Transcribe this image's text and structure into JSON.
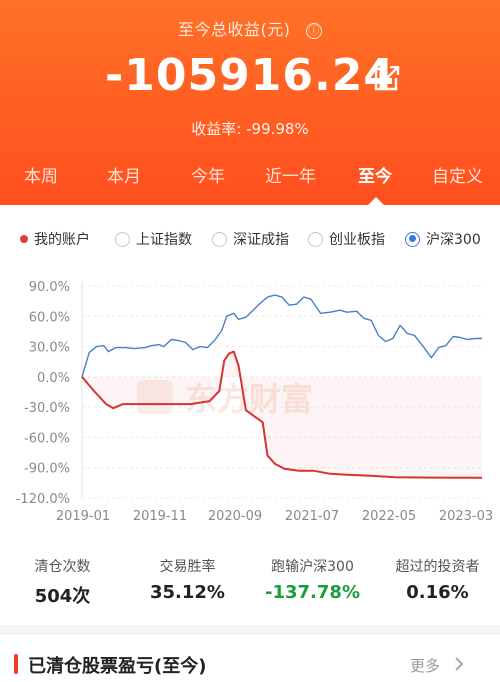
{
  "header": {
    "title": "至今总收益(元)",
    "info_icon": "ⓘ",
    "amount": "-105916.24",
    "rate_label": "收益率:",
    "rate_value": "-99.98%"
  },
  "tabs": [
    {
      "label": "本周"
    },
    {
      "label": "本月"
    },
    {
      "label": "今年"
    },
    {
      "label": "近一年"
    },
    {
      "label": "至今",
      "active": true
    },
    {
      "label": "自定义"
    }
  ],
  "legend": [
    {
      "label": "我的账户",
      "type": "dot"
    },
    {
      "label": "上证指数",
      "type": "radio",
      "selected": false
    },
    {
      "label": "深证成指",
      "type": "radio",
      "selected": false
    },
    {
      "label": "创业板指",
      "type": "radio",
      "selected": false
    },
    {
      "label": "沪深300",
      "type": "radio",
      "selected": true
    }
  ],
  "chart_data": {
    "type": "line",
    "watermark": "东方财富",
    "y_ticks": [
      "90.0%",
      "60.0%",
      "30.0%",
      "0.0%",
      "-30.0%",
      "-60.0%",
      "-90.0%",
      "-120.0%"
    ],
    "x_ticks": [
      "2019-01",
      "2019-11",
      "2020-09",
      "2021-07",
      "2022-05",
      "2023-03"
    ],
    "ylim": [
      -120,
      90
    ],
    "grid": true,
    "series": [
      {
        "name": "沪深300",
        "color": "#4a7fc9",
        "points": [
          [
            0,
            0
          ],
          [
            0.3,
            24
          ],
          [
            0.6,
            30
          ],
          [
            0.9,
            31
          ],
          [
            1.1,
            25
          ],
          [
            1.4,
            29
          ],
          [
            1.8,
            29
          ],
          [
            2.2,
            28
          ],
          [
            2.6,
            29
          ],
          [
            2.9,
            31
          ],
          [
            3.2,
            32
          ],
          [
            3.4,
            30
          ],
          [
            3.7,
            37
          ],
          [
            4.0,
            36
          ],
          [
            4.3,
            34
          ],
          [
            4.6,
            27
          ],
          [
            4.9,
            30
          ],
          [
            5.2,
            29
          ],
          [
            5.5,
            36
          ],
          [
            5.8,
            46
          ],
          [
            6.0,
            60
          ],
          [
            6.3,
            63
          ],
          [
            6.5,
            57
          ],
          [
            6.8,
            59
          ],
          [
            7.1,
            66
          ],
          [
            7.4,
            73
          ],
          [
            7.7,
            79
          ],
          [
            8.0,
            81
          ],
          [
            8.3,
            79
          ],
          [
            8.6,
            71
          ],
          [
            8.9,
            72
          ],
          [
            9.2,
            79
          ],
          [
            9.5,
            77
          ],
          [
            9.9,
            63
          ],
          [
            10.3,
            64
          ],
          [
            10.7,
            66
          ],
          [
            11.0,
            64
          ],
          [
            11.4,
            65
          ],
          [
            11.7,
            58
          ],
          [
            12.0,
            56
          ],
          [
            12.3,
            41
          ],
          [
            12.6,
            35
          ],
          [
            12.9,
            38
          ],
          [
            13.2,
            51
          ],
          [
            13.5,
            43
          ],
          [
            13.8,
            41
          ],
          [
            14.1,
            32
          ],
          [
            14.5,
            19
          ],
          [
            14.8,
            29
          ],
          [
            15.1,
            31
          ],
          [
            15.4,
            40
          ],
          [
            15.7,
            39
          ],
          [
            16.0,
            37
          ],
          [
            16.3,
            38
          ],
          [
            16.6,
            38
          ]
        ]
      },
      {
        "name": "我的账户",
        "color": "#d83232",
        "points": [
          [
            0,
            0
          ],
          [
            0.5,
            -14
          ],
          [
            1.0,
            -27
          ],
          [
            1.3,
            -31
          ],
          [
            1.7,
            -27
          ],
          [
            2.5,
            -27
          ],
          [
            3.5,
            -27
          ],
          [
            4.5,
            -27
          ],
          [
            5.3,
            -24
          ],
          [
            5.7,
            -14
          ],
          [
            5.9,
            16
          ],
          [
            6.1,
            23
          ],
          [
            6.3,
            25
          ],
          [
            6.5,
            11
          ],
          [
            6.8,
            -33
          ],
          [
            7.2,
            -40
          ],
          [
            7.5,
            -45
          ],
          [
            7.7,
            -78
          ],
          [
            8.0,
            -86
          ],
          [
            8.4,
            -91
          ],
          [
            9.0,
            -93
          ],
          [
            9.6,
            -93
          ],
          [
            10.3,
            -96
          ],
          [
            11.0,
            -97
          ],
          [
            12.0,
            -98
          ],
          [
            13.0,
            -99.5
          ],
          [
            14.5,
            -99.8
          ],
          [
            16.6,
            -99.98
          ]
        ]
      }
    ]
  },
  "stats": [
    {
      "label": "清仓次数",
      "value": "504次",
      "color": "#222"
    },
    {
      "label": "交易胜率",
      "value": "35.12%",
      "color": "#222"
    },
    {
      "label": "跑输沪深300",
      "value": "-137.78%",
      "color": "#1a9e3c"
    },
    {
      "label": "超过的投资者",
      "value": "0.16%",
      "color": "#222"
    }
  ],
  "section": {
    "title": "已清仓股票盈亏(至今)",
    "more": "更多"
  }
}
